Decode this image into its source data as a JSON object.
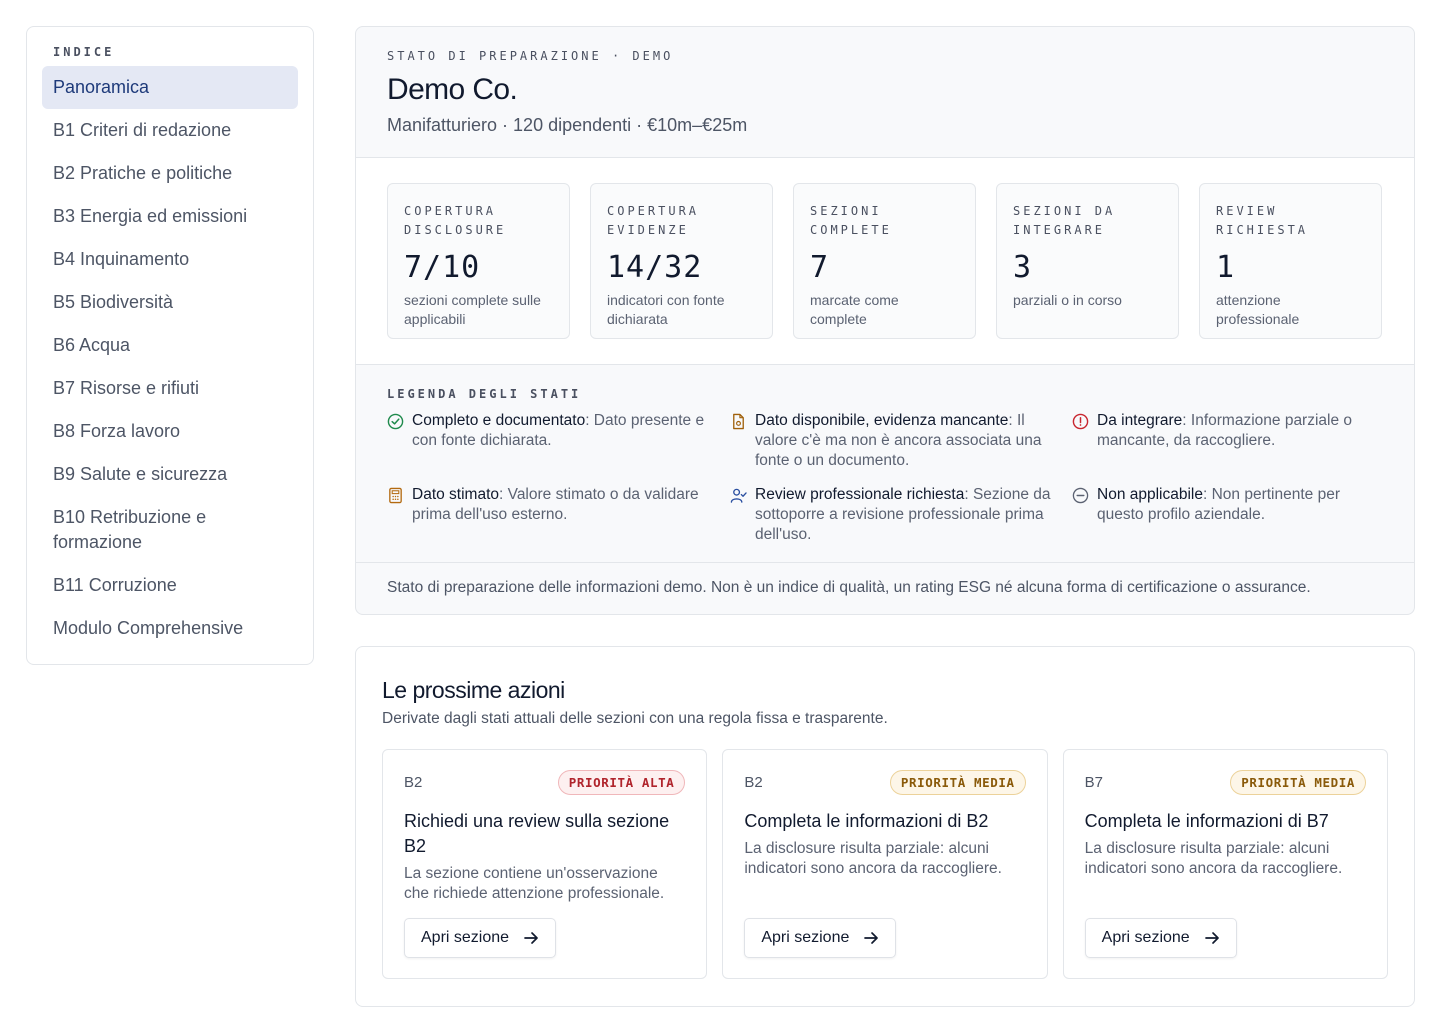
{
  "sidebar": {
    "heading": "INDICE",
    "items": [
      {
        "label": "Panoramica"
      },
      {
        "label": "B1 Criteri di redazione"
      },
      {
        "label": "B2 Pratiche e politiche"
      },
      {
        "label": "B3 Energia ed emissioni"
      },
      {
        "label": "B4 Inquinamento"
      },
      {
        "label": "B5 Biodiversità"
      },
      {
        "label": "B6 Acqua"
      },
      {
        "label": "B7 Risorse e rifiuti"
      },
      {
        "label": "B8 Forza lavoro"
      },
      {
        "label": "B9 Salute e sicurezza"
      },
      {
        "label": "B10 Retribuzione e formazione"
      },
      {
        "label": "B11 Corruzione"
      },
      {
        "label": "Modulo Comprehensive"
      }
    ]
  },
  "status": {
    "eyebrow": "STATO DI PREPARAZIONE · DEMO",
    "company": "Demo Co.",
    "company_sub": "Manifatturiero · 120 dipendenti · €10m–€25m",
    "metrics": [
      {
        "label": "COPERTURA DISCLOSURE",
        "value": "7/10",
        "desc": "sezioni complete sulle applicabili"
      },
      {
        "label": "COPERTURA EVIDENZE",
        "value": "14/32",
        "desc": "indicatori con fonte dichiarata"
      },
      {
        "label": "SEZIONI COMPLETE",
        "value": "7",
        "desc": "marcate come complete"
      },
      {
        "label": "SEZIONI DA INTEGRARE",
        "value": "3",
        "desc": "parziali o in corso"
      },
      {
        "label": "REVIEW RICHIESTA",
        "value": "1",
        "desc": "attenzione professionale"
      }
    ],
    "legend_title": "LEGENDA DEGLI STATI",
    "legend": [
      {
        "icon": "check-circle-icon",
        "name": "Completo e documentato",
        "text": ": Dato presente e con fonte dichiarata.",
        "color": "#1f8a4c"
      },
      {
        "icon": "document-icon",
        "name": "Dato disponibile, evidenza mancante",
        "text": ": Il valore c'è ma non è ancora associata una fonte o un documento.",
        "color": "#a0600a"
      },
      {
        "icon": "alert-circle-icon",
        "name": "Da integrare",
        "text": ": Informazione parziale o mancante, da raccogliere.",
        "color": "#c8262f"
      },
      {
        "icon": "calculator-icon",
        "name": "Dato stimato",
        "text": ": Valore stimato o da validare prima dell'uso esterno.",
        "color": "#b36a10"
      },
      {
        "icon": "user-check-icon",
        "name": "Review professionale richiesta",
        "text": ": Sezione da sottoporre a revisione professionale prima dell'uso.",
        "color": "#2a4fa0"
      },
      {
        "icon": "minus-circle-icon",
        "name": "Non applicabile",
        "text": ": Non pertinente per questo profilo aziendale.",
        "color": "#5b6272"
      }
    ],
    "disclaimer": "Stato di preparazione delle informazioni demo. Non è un indice di qualità, un rating ESG né alcuna forma di certificazione o assurance."
  },
  "actions": {
    "title": "Le prossime azioni",
    "subtitle": "Derivate dagli stati attuali delle sezioni con una regola fissa e trasparente.",
    "cards": [
      {
        "code": "B2",
        "badge": "PRIORITÀ ALTA",
        "level": "high",
        "title": "Richiedi una review sulla sezione B2",
        "desc": "La sezione contiene un'osservazione che richiede attenzione professionale.",
        "button": "Apri sezione"
      },
      {
        "code": "B2",
        "badge": "PRIORITÀ MEDIA",
        "level": "med",
        "title": "Completa le informazioni di B2",
        "desc": "La disclosure risulta parziale: alcuni indicatori sono ancora da raccogliere.",
        "button": "Apri sezione"
      },
      {
        "code": "B7",
        "badge": "PRIORITÀ MEDIA",
        "level": "med",
        "title": "Completa le informazioni di B7",
        "desc": "La disclosure risulta parziale: alcuni indicatori sono ancora da raccogliere.",
        "button": "Apri sezione"
      }
    ]
  }
}
